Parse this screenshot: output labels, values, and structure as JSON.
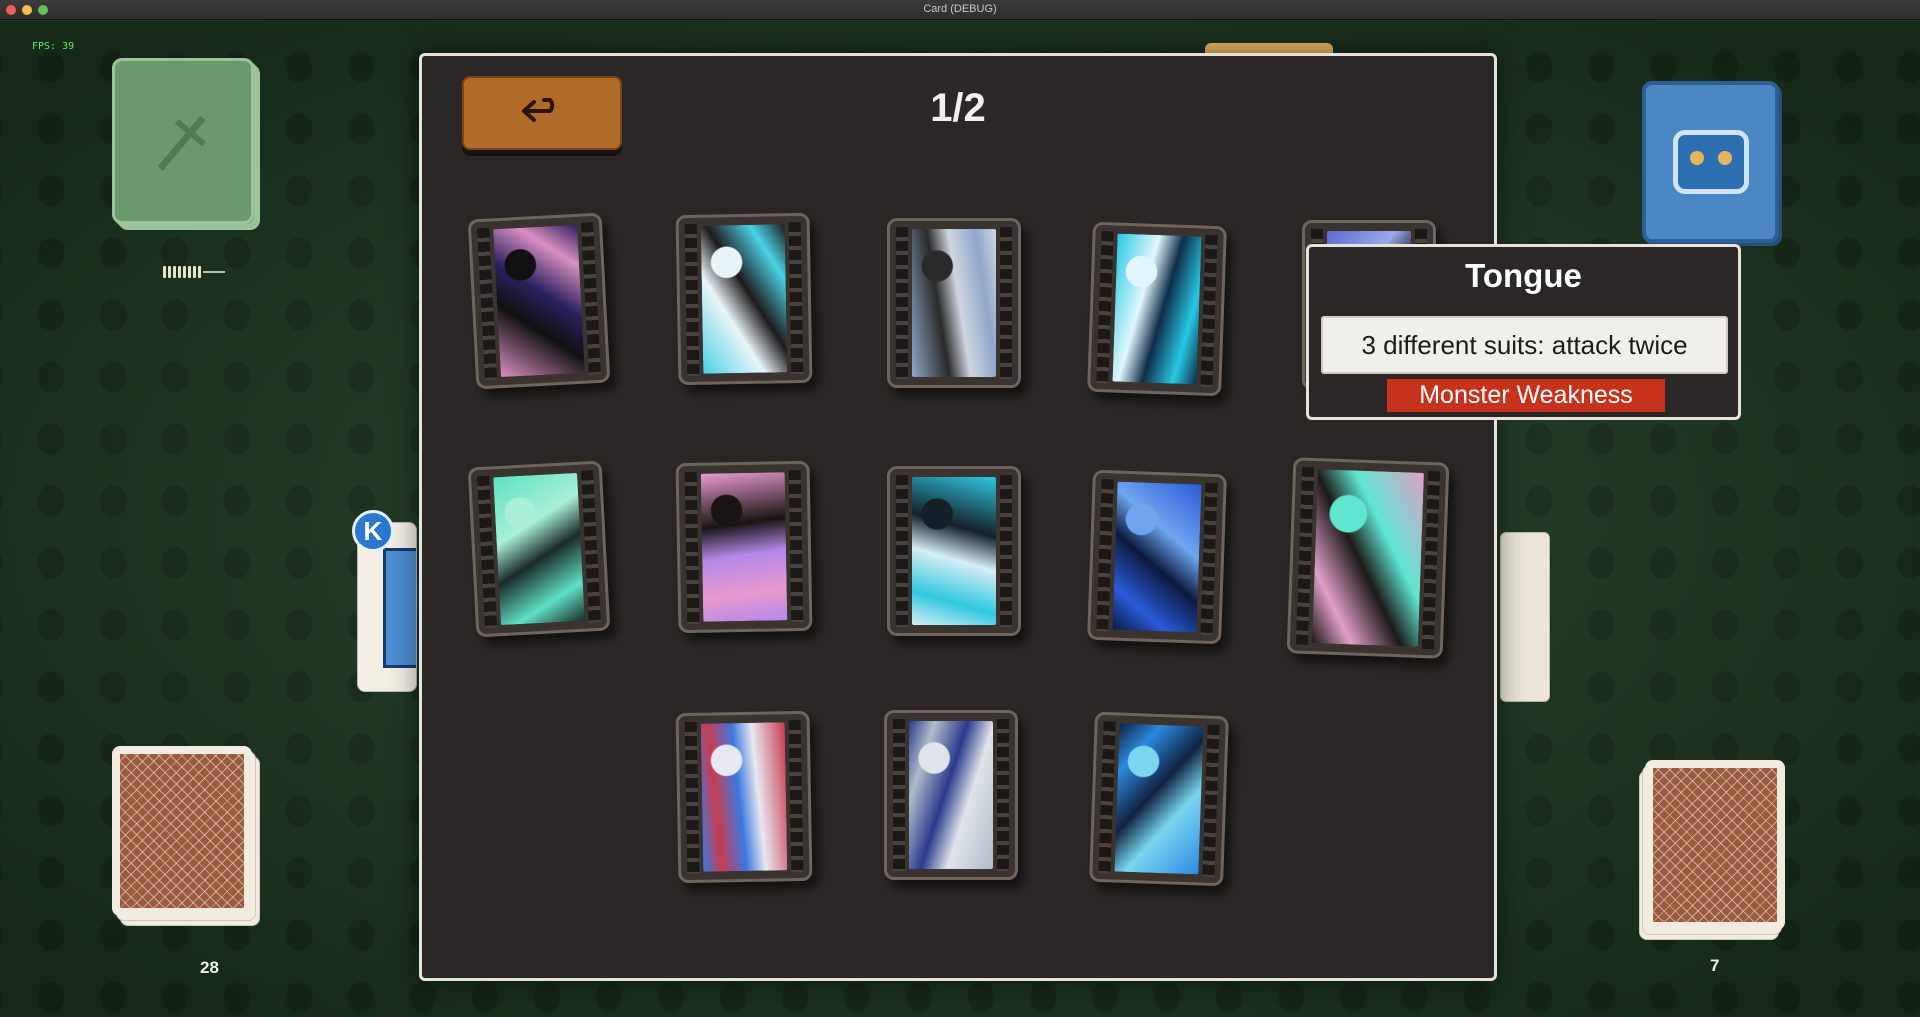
{
  "window": {
    "title": "Card (DEBUG)"
  },
  "hud": {
    "fps": "FPS: 39"
  },
  "decks": {
    "left_count": "28",
    "right_count": "7",
    "king_badge": "K"
  },
  "viewer": {
    "page": "1/2",
    "back_icon": "return-arrow-icon",
    "cards": [
      {
        "name": "card-1",
        "colors": [
          "#d98fc2",
          "#2a1f5c",
          "#111111"
        ]
      },
      {
        "name": "card-2",
        "colors": [
          "#4ad2e6",
          "#1e1a1c",
          "#e8f4f8"
        ]
      },
      {
        "name": "card-3",
        "colors": [
          "#8fa7c9",
          "#cfd6e0",
          "#2a2a2a"
        ]
      },
      {
        "name": "card-4",
        "colors": [
          "#27c9e3",
          "#0f2d4a",
          "#e0f6fb"
        ]
      },
      {
        "name": "card-5",
        "colors": [
          "#5a6ad0",
          "#1a1a2e",
          "#9aa8e8"
        ]
      },
      {
        "name": "card-6",
        "colors": [
          "#5ee0c2",
          "#1b2a2a",
          "#a8f0d8"
        ]
      },
      {
        "name": "card-7",
        "colors": [
          "#e89ad0",
          "#b388e8",
          "#1a1414"
        ]
      },
      {
        "name": "card-8",
        "colors": [
          "#30c8e0",
          "#d6eef4",
          "#142028"
        ]
      },
      {
        "name": "card-9",
        "colors": [
          "#2a5ad8",
          "#0b1a3e",
          "#6ea6f0"
        ]
      },
      {
        "name": "card-10",
        "colors": [
          "#e0a0c8",
          "#1c1818",
          "#5ee6d0"
        ]
      },
      {
        "name": "card-11",
        "colors": [
          "#c83c50",
          "#3c78e0",
          "#e8e8f0"
        ]
      },
      {
        "name": "card-12",
        "colors": [
          "#b0bcc8",
          "#2a3a8c",
          "#e0e4ea"
        ]
      },
      {
        "name": "card-13",
        "colors": [
          "#2c8ae0",
          "#0f2240",
          "#7ad6f0"
        ]
      }
    ]
  },
  "tooltip": {
    "title": "Tongue",
    "description": "3 different suits: attack twice",
    "tag": "Monster Weakness",
    "tag_color": "#c7321c"
  }
}
